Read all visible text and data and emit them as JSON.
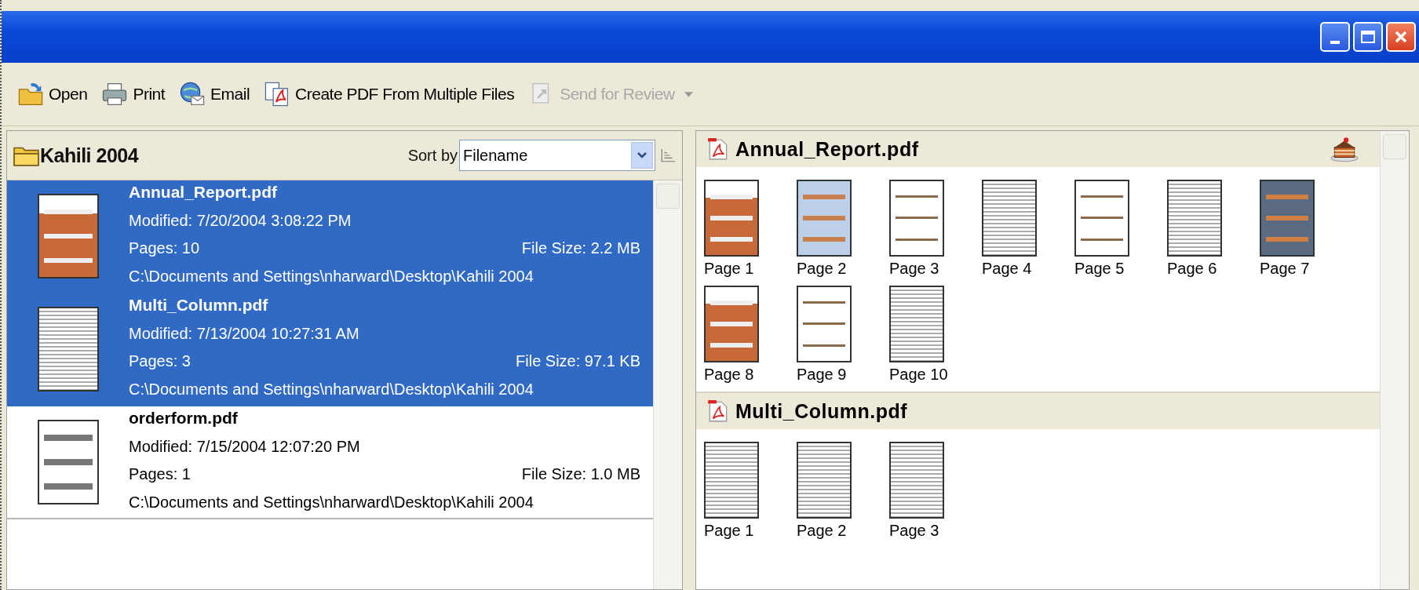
{
  "toolbar": [
    {
      "label": "Open",
      "kind": "open",
      "disabled": false
    },
    {
      "label": "Print",
      "kind": "print",
      "disabled": false
    },
    {
      "label": "Email",
      "kind": "email",
      "disabled": false
    },
    {
      "label": "Create PDF From Multiple Files",
      "kind": "create",
      "disabled": false
    },
    {
      "label": "Send for Review",
      "kind": "review",
      "disabled": true,
      "dropdown": true
    }
  ],
  "folder": {
    "title": "Kahili 2004",
    "sort_label": "Sort by",
    "sort_value": "Filename"
  },
  "files": [
    {
      "name": "Annual_Report.pdf",
      "modified": "Modified: 7/20/2004 3:08:22 PM",
      "pages": "Pages: 10",
      "size": "File Size: 2.2 MB",
      "path": "C:\\Documents and Settings\\nharward\\Desktop\\Kahili 2004",
      "selected": true,
      "kind": "cover"
    },
    {
      "name": "Multi_Column.pdf",
      "modified": "Modified: 7/13/2004 10:27:31 AM",
      "pages": "Pages: 3",
      "size": "File Size: 97.1 KB",
      "path": "C:\\Documents and Settings\\nharward\\Desktop\\Kahili 2004",
      "selected": true,
      "kind": "columns"
    },
    {
      "name": "orderform.pdf",
      "modified": "Modified: 7/15/2004 12:07:20 PM",
      "pages": "Pages: 1",
      "size": "File Size: 1.0 MB",
      "path": "C:\\Documents and Settings\\nharward\\Desktop\\Kahili 2004",
      "selected": false,
      "kind": "form"
    }
  ],
  "documents": [
    {
      "title": "Annual_Report.pdf",
      "pages": [
        {
          "label": "Page 1",
          "kind": "cover"
        },
        {
          "label": "Page 2",
          "kind": "tinted"
        },
        {
          "label": "Page 3",
          "kind": "text"
        },
        {
          "label": "Page 4",
          "kind": "columns"
        },
        {
          "label": "Page 5",
          "kind": "text"
        },
        {
          "label": "Page 6",
          "kind": "columns"
        },
        {
          "label": "Page 7",
          "kind": "dark"
        },
        {
          "label": "Page 8",
          "kind": "cover"
        },
        {
          "label": "Page 9",
          "kind": "text"
        },
        {
          "label": "Page 10",
          "kind": "columns"
        }
      ]
    },
    {
      "title": "Multi_Column.pdf",
      "pages": [
        {
          "label": "Page 1",
          "kind": "columns"
        },
        {
          "label": "Page 2",
          "kind": "columns"
        },
        {
          "label": "Page 3",
          "kind": "columns"
        }
      ]
    }
  ]
}
